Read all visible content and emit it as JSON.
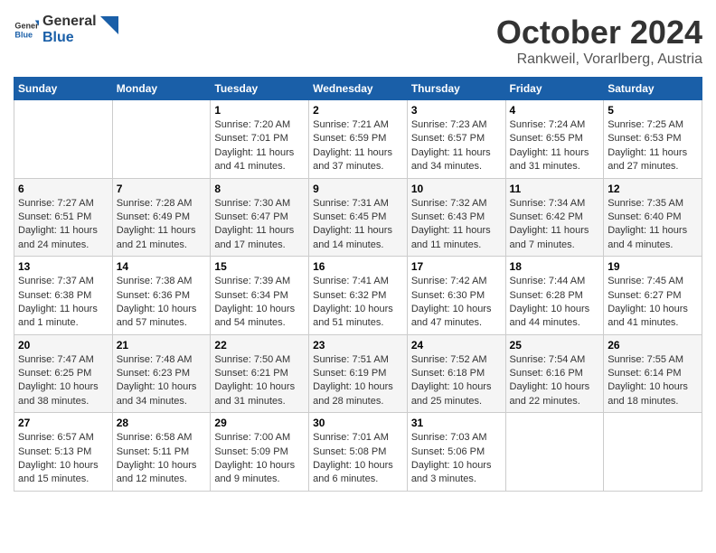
{
  "header": {
    "logo_general": "General",
    "logo_blue": "Blue",
    "month_title": "October 2024",
    "location": "Rankweil, Vorarlberg, Austria"
  },
  "calendar": {
    "days_of_week": [
      "Sunday",
      "Monday",
      "Tuesday",
      "Wednesday",
      "Thursday",
      "Friday",
      "Saturday"
    ],
    "weeks": [
      [
        {
          "day": "",
          "info": ""
        },
        {
          "day": "",
          "info": ""
        },
        {
          "day": "1",
          "info": "Sunrise: 7:20 AM\nSunset: 7:01 PM\nDaylight: 11 hours and 41 minutes."
        },
        {
          "day": "2",
          "info": "Sunrise: 7:21 AM\nSunset: 6:59 PM\nDaylight: 11 hours and 37 minutes."
        },
        {
          "day": "3",
          "info": "Sunrise: 7:23 AM\nSunset: 6:57 PM\nDaylight: 11 hours and 34 minutes."
        },
        {
          "day": "4",
          "info": "Sunrise: 7:24 AM\nSunset: 6:55 PM\nDaylight: 11 hours and 31 minutes."
        },
        {
          "day": "5",
          "info": "Sunrise: 7:25 AM\nSunset: 6:53 PM\nDaylight: 11 hours and 27 minutes."
        }
      ],
      [
        {
          "day": "6",
          "info": "Sunrise: 7:27 AM\nSunset: 6:51 PM\nDaylight: 11 hours and 24 minutes."
        },
        {
          "day": "7",
          "info": "Sunrise: 7:28 AM\nSunset: 6:49 PM\nDaylight: 11 hours and 21 minutes."
        },
        {
          "day": "8",
          "info": "Sunrise: 7:30 AM\nSunset: 6:47 PM\nDaylight: 11 hours and 17 minutes."
        },
        {
          "day": "9",
          "info": "Sunrise: 7:31 AM\nSunset: 6:45 PM\nDaylight: 11 hours and 14 minutes."
        },
        {
          "day": "10",
          "info": "Sunrise: 7:32 AM\nSunset: 6:43 PM\nDaylight: 11 hours and 11 minutes."
        },
        {
          "day": "11",
          "info": "Sunrise: 7:34 AM\nSunset: 6:42 PM\nDaylight: 11 hours and 7 minutes."
        },
        {
          "day": "12",
          "info": "Sunrise: 7:35 AM\nSunset: 6:40 PM\nDaylight: 11 hours and 4 minutes."
        }
      ],
      [
        {
          "day": "13",
          "info": "Sunrise: 7:37 AM\nSunset: 6:38 PM\nDaylight: 11 hours and 1 minute."
        },
        {
          "day": "14",
          "info": "Sunrise: 7:38 AM\nSunset: 6:36 PM\nDaylight: 10 hours and 57 minutes."
        },
        {
          "day": "15",
          "info": "Sunrise: 7:39 AM\nSunset: 6:34 PM\nDaylight: 10 hours and 54 minutes."
        },
        {
          "day": "16",
          "info": "Sunrise: 7:41 AM\nSunset: 6:32 PM\nDaylight: 10 hours and 51 minutes."
        },
        {
          "day": "17",
          "info": "Sunrise: 7:42 AM\nSunset: 6:30 PM\nDaylight: 10 hours and 47 minutes."
        },
        {
          "day": "18",
          "info": "Sunrise: 7:44 AM\nSunset: 6:28 PM\nDaylight: 10 hours and 44 minutes."
        },
        {
          "day": "19",
          "info": "Sunrise: 7:45 AM\nSunset: 6:27 PM\nDaylight: 10 hours and 41 minutes."
        }
      ],
      [
        {
          "day": "20",
          "info": "Sunrise: 7:47 AM\nSunset: 6:25 PM\nDaylight: 10 hours and 38 minutes."
        },
        {
          "day": "21",
          "info": "Sunrise: 7:48 AM\nSunset: 6:23 PM\nDaylight: 10 hours and 34 minutes."
        },
        {
          "day": "22",
          "info": "Sunrise: 7:50 AM\nSunset: 6:21 PM\nDaylight: 10 hours and 31 minutes."
        },
        {
          "day": "23",
          "info": "Sunrise: 7:51 AM\nSunset: 6:19 PM\nDaylight: 10 hours and 28 minutes."
        },
        {
          "day": "24",
          "info": "Sunrise: 7:52 AM\nSunset: 6:18 PM\nDaylight: 10 hours and 25 minutes."
        },
        {
          "day": "25",
          "info": "Sunrise: 7:54 AM\nSunset: 6:16 PM\nDaylight: 10 hours and 22 minutes."
        },
        {
          "day": "26",
          "info": "Sunrise: 7:55 AM\nSunset: 6:14 PM\nDaylight: 10 hours and 18 minutes."
        }
      ],
      [
        {
          "day": "27",
          "info": "Sunrise: 6:57 AM\nSunset: 5:13 PM\nDaylight: 10 hours and 15 minutes."
        },
        {
          "day": "28",
          "info": "Sunrise: 6:58 AM\nSunset: 5:11 PM\nDaylight: 10 hours and 12 minutes."
        },
        {
          "day": "29",
          "info": "Sunrise: 7:00 AM\nSunset: 5:09 PM\nDaylight: 10 hours and 9 minutes."
        },
        {
          "day": "30",
          "info": "Sunrise: 7:01 AM\nSunset: 5:08 PM\nDaylight: 10 hours and 6 minutes."
        },
        {
          "day": "31",
          "info": "Sunrise: 7:03 AM\nSunset: 5:06 PM\nDaylight: 10 hours and 3 minutes."
        },
        {
          "day": "",
          "info": ""
        },
        {
          "day": "",
          "info": ""
        }
      ]
    ]
  }
}
